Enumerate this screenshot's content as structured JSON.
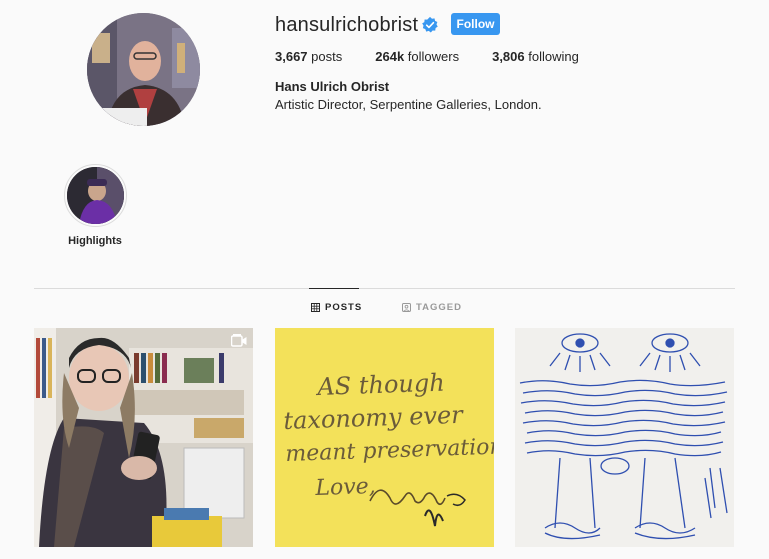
{
  "profile": {
    "username": "hansulrichobrist",
    "follow_label": "Follow",
    "full_name": "Hans Ulrich Obrist",
    "bio": "Artistic Director, Serpentine Galleries, London.",
    "stats": {
      "posts_count": "3,667",
      "posts_label": "posts",
      "followers_count": "264k",
      "followers_label": "followers",
      "following_count": "3,806",
      "following_label": "following"
    },
    "avatar_icon": "profile-photo"
  },
  "highlights": [
    {
      "label": "Highlights"
    }
  ],
  "tabs": [
    {
      "label": "POSTS",
      "icon": "grid-icon",
      "active": true
    },
    {
      "label": "TAGGED",
      "icon": "tagged-icon",
      "active": false
    }
  ],
  "posts": [
    {
      "type": "video",
      "icon": "video-badge-icon"
    },
    {
      "type": "image",
      "lines": [
        "AS though",
        "taxonomy ever",
        "meant preservation",
        "Love,"
      ]
    },
    {
      "type": "image"
    }
  ],
  "colors": {
    "follow_button": "#3897f0",
    "verified_badge": "#3897f0",
    "background": "#fafafa",
    "text": "#262626",
    "divider": "#dbdbdb"
  }
}
